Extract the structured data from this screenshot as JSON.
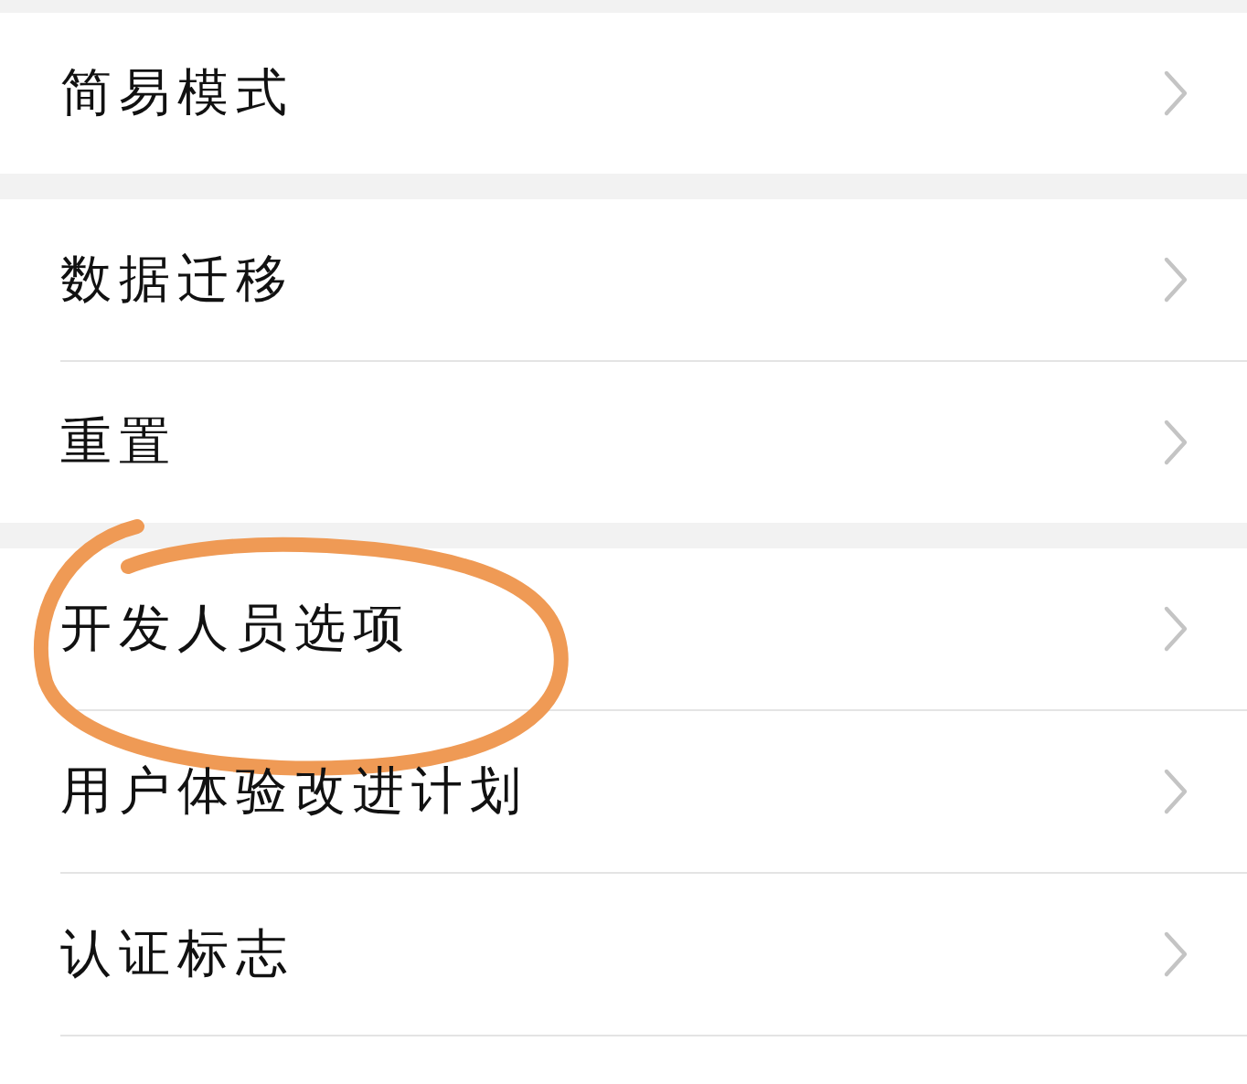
{
  "sections": [
    {
      "items": [
        {
          "label": "简易模式",
          "circled": false
        }
      ]
    },
    {
      "items": [
        {
          "label": "数据迁移",
          "circled": false
        },
        {
          "label": "重置",
          "circled": false
        }
      ]
    },
    {
      "items": [
        {
          "label": "开发人员选项",
          "circled": true
        },
        {
          "label": "用户体验改进计划",
          "circled": false
        },
        {
          "label": "认证标志",
          "circled": false
        }
      ]
    }
  ]
}
